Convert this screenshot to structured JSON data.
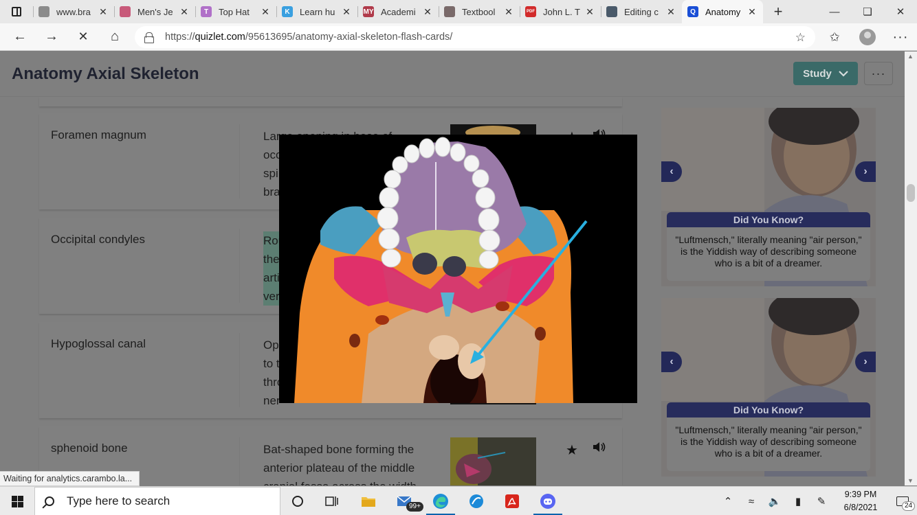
{
  "browser": {
    "tabs": [
      {
        "title": "www.bra",
        "fav": "globe-icon",
        "color": "#8b8b8b",
        "glyph": ""
      },
      {
        "title": "Men's Je",
        "fav": "brand-icon",
        "color": "#c85a7a",
        "glyph": ""
      },
      {
        "title": "Top Hat",
        "fav": "tophat-icon",
        "color": "#b070c8",
        "glyph": "T"
      },
      {
        "title": "Learn hu",
        "fav": "k-icon",
        "color": "#3aa0e0",
        "glyph": "K"
      },
      {
        "title": "Academi",
        "fav": "my-icon",
        "color": "#b03a4a",
        "glyph": "MY"
      },
      {
        "title": "Textbool",
        "fav": "textbook-icon",
        "color": "#7a6a6a",
        "glyph": ""
      },
      {
        "title": "John L. T",
        "fav": "pdf-icon",
        "color": "#d22b2b",
        "glyph": "PDF"
      },
      {
        "title": "Editing c",
        "fav": "robot-icon",
        "color": "#4a5a6a",
        "glyph": ""
      },
      {
        "title": "Anatomy",
        "fav": "quizlet-icon",
        "color": "#1a4fd6",
        "glyph": "Q"
      }
    ],
    "url_prefix": "https://",
    "url_host": "quizlet.com",
    "url_path": "/95613695/anatomy-axial-skeleton-flash-cards/"
  },
  "page": {
    "title": "Anatomy Axial Skeleton",
    "study_label": "Study",
    "more_label": "···"
  },
  "cards": [
    {
      "term": "Foramen magnum",
      "def": [
        "Large opening in base of",
        "occ",
        "spi",
        "bra"
      ],
      "highlight": false
    },
    {
      "term": "Occipital condyles",
      "def": [
        "Rou",
        "the",
        "arti",
        "ver"
      ],
      "highlight": true
    },
    {
      "term": "Hypoglossal canal",
      "def": [
        "Op",
        "to t",
        "thro",
        "ner"
      ],
      "highlight": false
    },
    {
      "term": "sphenoid bone",
      "def": [
        "Bat-shaped bone forming the",
        "anterior plateau of the middle",
        "cranial fossa across the width"
      ],
      "highlight": false
    }
  ],
  "ads": [
    {
      "heading": "Did You Know?",
      "fact": "\"Luftmensch,\" literally meaning \"air person,\" is the Yiddish way of describing someone who is a bit of a dreamer."
    },
    {
      "heading": "Did You Know?",
      "fact": "\"Luftmensch,\" literally meaning \"air person,\" is the Yiddish way of describing someone who is a bit of a dreamer."
    }
  ],
  "status_text": "Waiting for analytics.carambo.la...",
  "taskbar": {
    "search_placeholder": "Type here to search",
    "mail_badge": "99+",
    "time": "9:39 PM",
    "date": "6/8/2021",
    "notifications": "24"
  }
}
